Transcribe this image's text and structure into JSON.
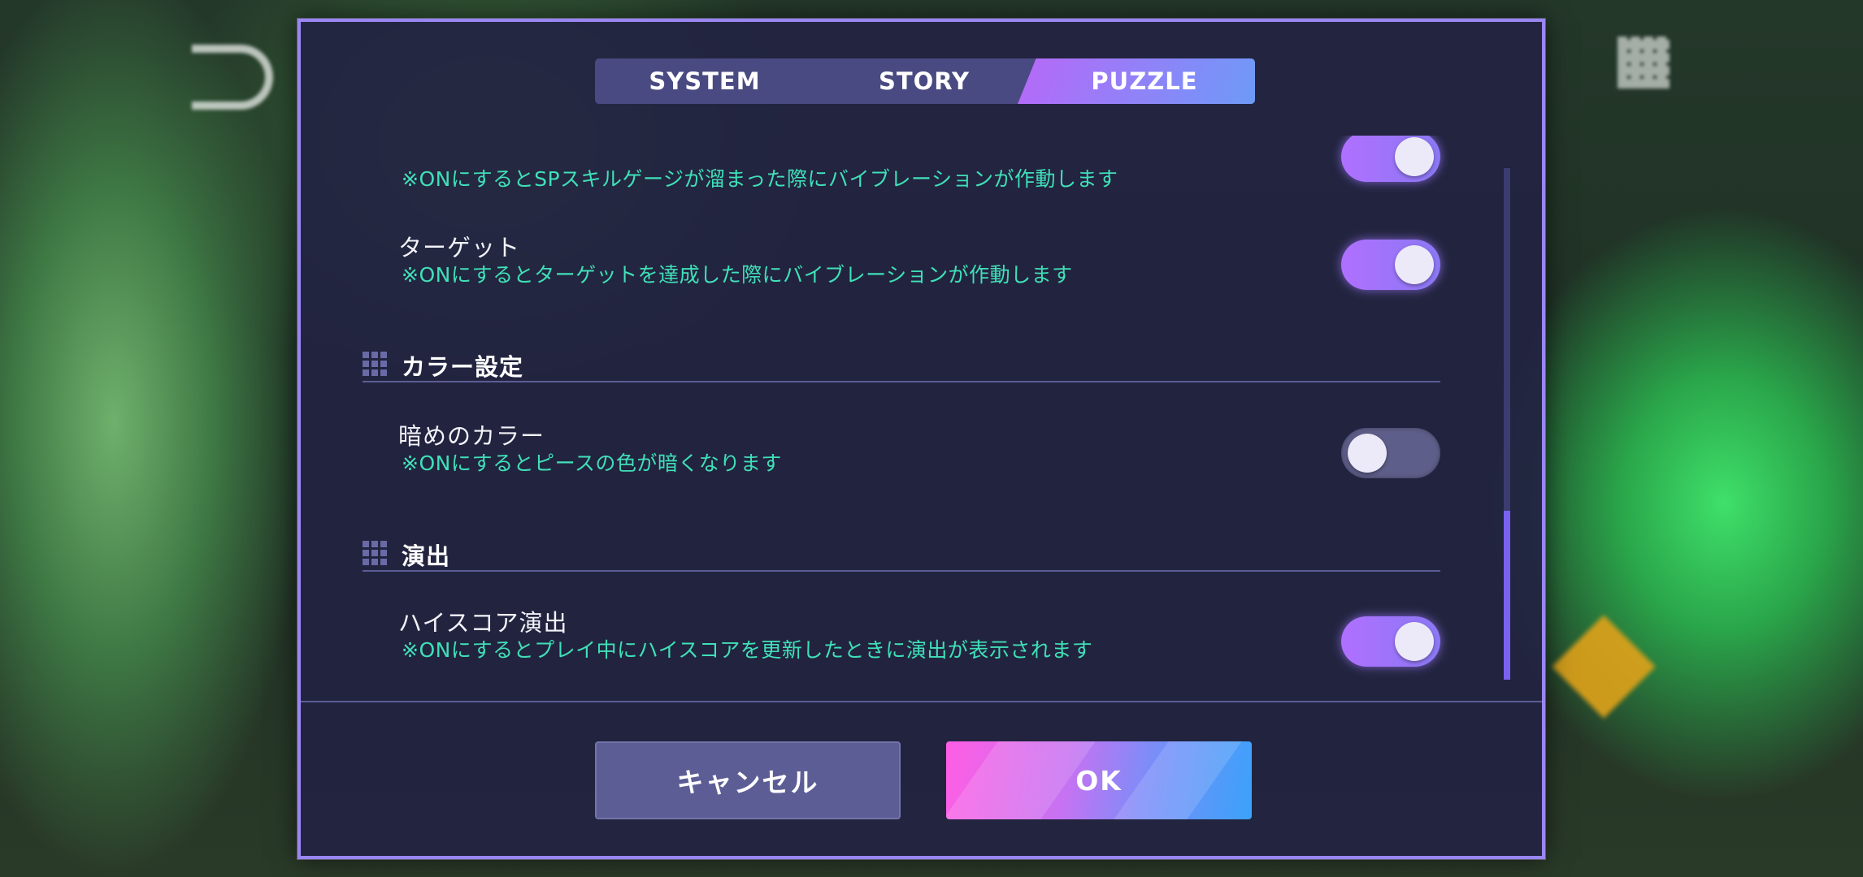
{
  "tabs": [
    {
      "label": "SYSTEM",
      "active": false
    },
    {
      "label": "STORY",
      "active": false
    },
    {
      "label": "PUZZLE",
      "active": true
    }
  ],
  "settings": {
    "sp_skill": {
      "desc": "※ONにするとSPスキルゲージが溜まった際にバイブレーションが作動します",
      "state": "on"
    },
    "target": {
      "label": "ターゲット",
      "desc": "※ONにするとターゲットを達成した際にバイブレーションが作動します",
      "state": "on"
    },
    "dark_color": {
      "label": "暗めのカラー",
      "desc": "※ONにするとピースの色が暗くなります",
      "state": "off"
    },
    "highscore_effect": {
      "label": "ハイスコア演出",
      "desc": "※ONにするとプレイ中にハイスコアを更新したときに演出が表示されます",
      "state": "on"
    }
  },
  "sections": {
    "color": "カラー設定",
    "effect": "演出"
  },
  "scroll": {
    "position": 0.58,
    "thumb_fraction": 0.33
  },
  "buttons": {
    "cancel": "キャンセル",
    "ok": "OK"
  },
  "colors": {
    "accent_purple": "#b070ff",
    "desc_text": "#3fe0b8",
    "ok_pink": "#ff5ee4",
    "ok_blue": "#3aa2fa"
  }
}
